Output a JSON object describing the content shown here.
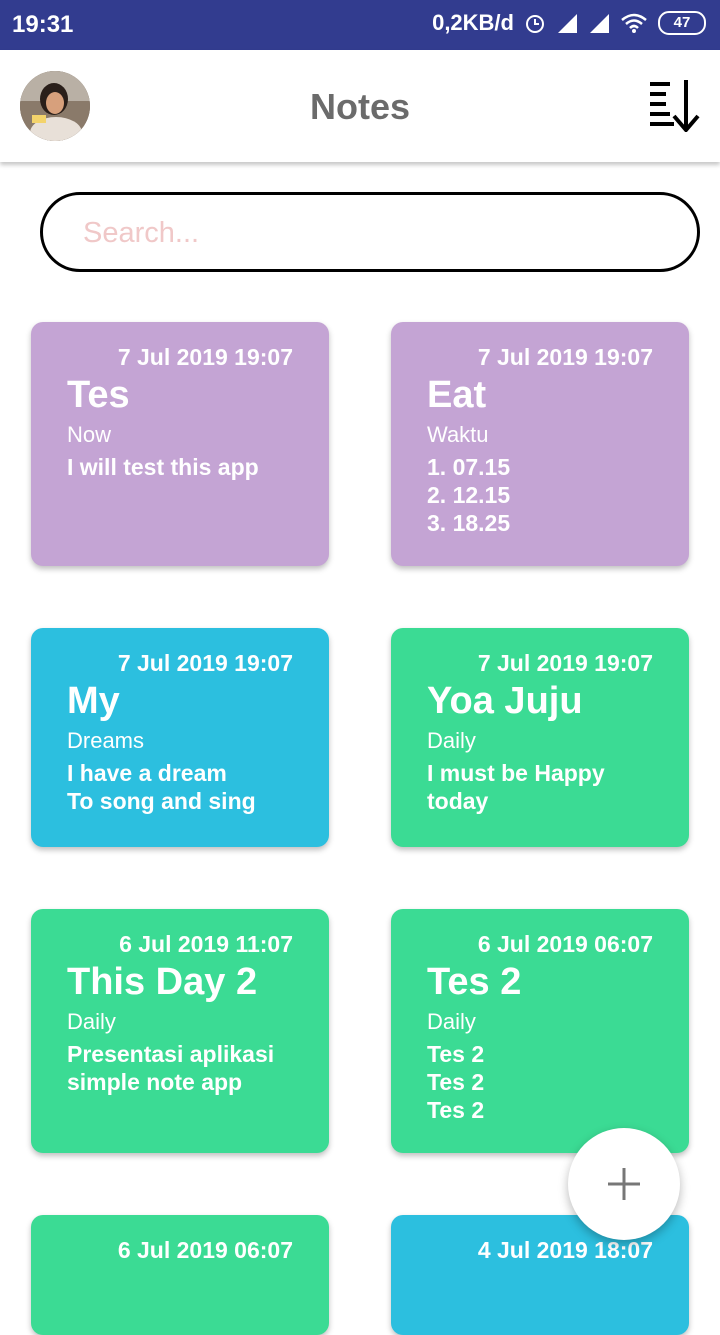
{
  "status_bar": {
    "time": "19:31",
    "speed": "0,2KB/d",
    "battery": "47",
    "icons": [
      "alarm-icon",
      "signal-icon",
      "signal-icon",
      "wifi-icon",
      "battery-icon"
    ]
  },
  "app_bar": {
    "title": "Notes",
    "avatar_icon": "user-avatar",
    "sort_icon": "sort-descending-icon"
  },
  "search": {
    "placeholder": "Search...",
    "value": ""
  },
  "notes": [
    {
      "date": "7 Jul 2019 19:07",
      "title": "Tes",
      "category": "Now",
      "body": [
        "I will test this app"
      ],
      "color": "#c4a4d4"
    },
    {
      "date": "7 Jul 2019 19:07",
      "title": "Eat",
      "category": "Waktu",
      "body": [
        "1. 07.15",
        "2. 12.15",
        "3. 18.25"
      ],
      "color": "#c4a4d4"
    },
    {
      "date": "7 Jul 2019 19:07",
      "title": "My",
      "category": "Dreams",
      "body": [
        "I have a dream",
        "To song and sing"
      ],
      "color": "#2cbfdf"
    },
    {
      "date": "7 Jul 2019 19:07",
      "title": "Yoa Juju",
      "category": "Daily",
      "body": [
        "I must be Happy",
        "today"
      ],
      "color": "#3bdb94"
    },
    {
      "date": "6 Jul 2019 11:07",
      "title": "This Day 2",
      "category": "Daily",
      "body": [
        "Presentasi aplikasi",
        "simple note app"
      ],
      "color": "#3bdb94"
    },
    {
      "date": "6 Jul 2019 06:07",
      "title": "Tes 2",
      "category": "Daily",
      "body": [
        "Tes 2",
        "Tes 2",
        "Tes 2"
      ],
      "color": "#3bdb94"
    },
    {
      "date": "6 Jul 2019 06:07",
      "title": "",
      "category": "",
      "body": [],
      "color": "#3bdb94"
    },
    {
      "date": "4 Jul 2019 18:07",
      "title": "",
      "category": "",
      "body": [],
      "color": "#2cbfdf"
    }
  ],
  "fab": {
    "icon": "plus-icon"
  }
}
